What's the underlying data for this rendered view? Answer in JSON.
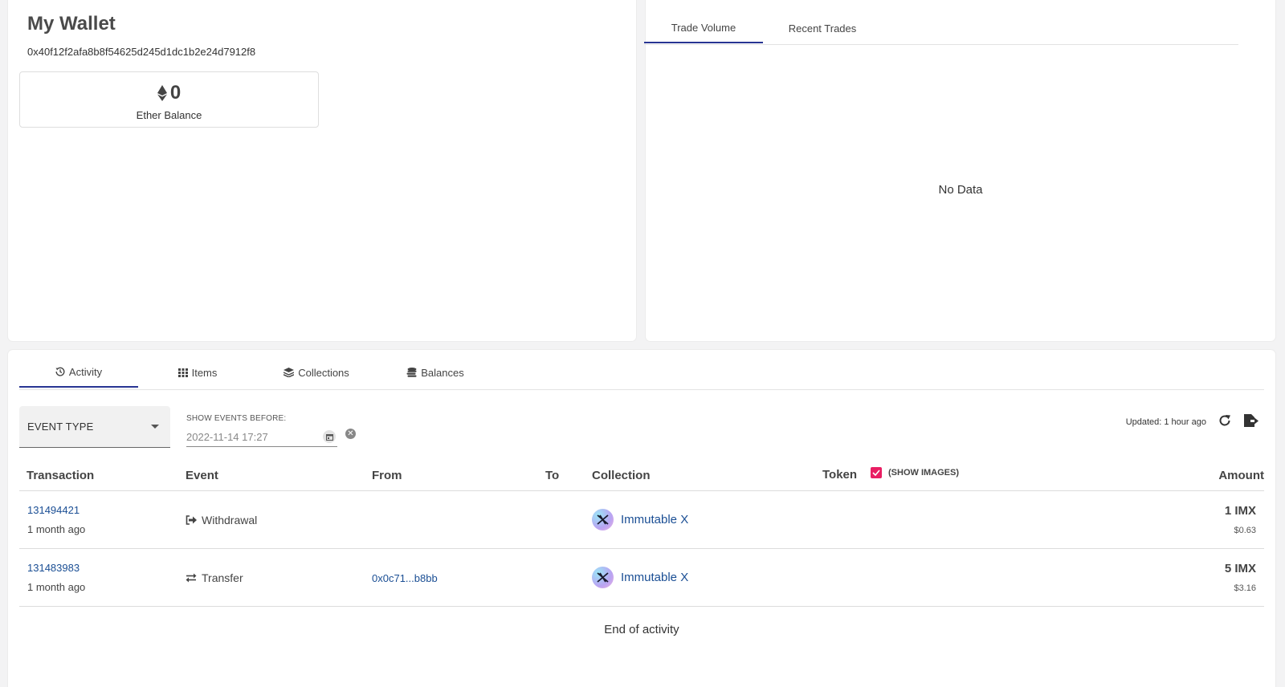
{
  "wallet": {
    "title": "My Wallet",
    "address": "0x40f12f2afa8b8f54625d245d1dc1b2e24d7912f8",
    "balance_value": "0",
    "balance_label": "Ether Balance"
  },
  "trade": {
    "tabs": [
      {
        "label": "Trade Volume",
        "active": true
      },
      {
        "label": "Recent Trades",
        "active": false
      }
    ],
    "empty_text": "No Data"
  },
  "activity": {
    "tabs": [
      {
        "label": "Activity",
        "icon": "history-icon",
        "active": true
      },
      {
        "label": "Items",
        "icon": "grid-icon",
        "active": false
      },
      {
        "label": "Collections",
        "icon": "layers-icon",
        "active": false
      },
      {
        "label": "Balances",
        "icon": "coins-icon",
        "active": false
      }
    ],
    "filter_label": "EVENT TYPE",
    "date_label": "SHOW EVENTS BEFORE:",
    "date_value": "2022-11-14 17:27",
    "updated_text": "Updated: 1 hour ago",
    "columns": {
      "transaction": "Transaction",
      "event": "Event",
      "from": "From",
      "to": "To",
      "collection": "Collection",
      "token": "Token",
      "show_images": "(SHOW IMAGES)",
      "amount": "Amount"
    },
    "rows": [
      {
        "tx_id": "131494421",
        "time": "1 month ago",
        "event": "Withdrawal",
        "event_icon": "withdrawal-icon",
        "from": "",
        "to": "",
        "collection": "Immutable X",
        "amount": "1 IMX",
        "usd": "$0.63"
      },
      {
        "tx_id": "131483983",
        "time": "1 month ago",
        "event": "Transfer",
        "event_icon": "transfer-icon",
        "from": "0x0c71...b8bb",
        "to": "",
        "collection": "Immutable X",
        "amount": "5 IMX",
        "usd": "$3.16"
      }
    ],
    "end_text": "End of activity"
  },
  "colors": {
    "accent": "#283593",
    "link": "#1a4e94",
    "checkbox": "#e91e63"
  }
}
